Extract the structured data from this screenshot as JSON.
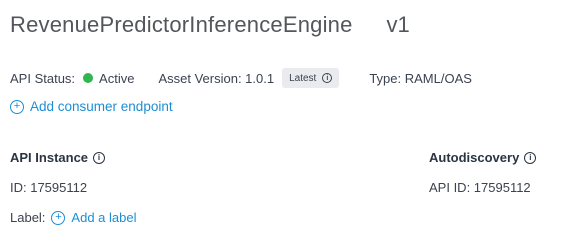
{
  "header": {
    "api_name": "RevenuePredictorInferenceEngine",
    "version": "v1"
  },
  "status_row": {
    "api_status_label": "API Status:",
    "api_status_value": "Active",
    "status_color": "#2fb64f",
    "asset_version_label": "Asset Version: 1.0.1",
    "latest_badge": "Latest",
    "type_label": "Type: RAML/OAS"
  },
  "actions": {
    "add_consumer_endpoint": "Add consumer endpoint",
    "add_label": "Add a label"
  },
  "api_instance": {
    "heading": "API Instance",
    "id_text": "ID: 17595112",
    "label_prefix": "Label:"
  },
  "autodiscovery": {
    "heading": "Autodiscovery",
    "api_id_text": "API ID: 17595112"
  },
  "icons": {
    "info": "info-icon",
    "plus": "plus-circle-icon",
    "status": "status-dot-icon"
  },
  "colors": {
    "link": "#1c8fd4",
    "title": "#53565d",
    "badge_bg": "#e9ebee"
  }
}
